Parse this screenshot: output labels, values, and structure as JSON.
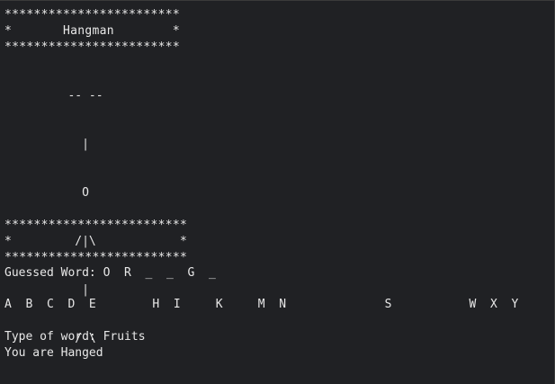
{
  "banner_top": {
    "border_line": "************************",
    "title_line": "*       Hangman        *",
    "border_line_bottom": "************************"
  },
  "gallows": [
    "         -- --",
    "           |",
    "           O",
    "          /|\\",
    "           |",
    "          / \\"
  ],
  "banner_bottom": {
    "border_line": "*************************",
    "middle_line": "*                       *",
    "border_line_bottom": "*************************"
  },
  "guessed_word": "Guessed Word: O  R  _  _  G  _",
  "remaining_letters": "A  B  C  D  E        H  I     K     M  N              S           W  X  Y",
  "word_type": "Type of word: Fruits",
  "status_message": "You are Hanged"
}
